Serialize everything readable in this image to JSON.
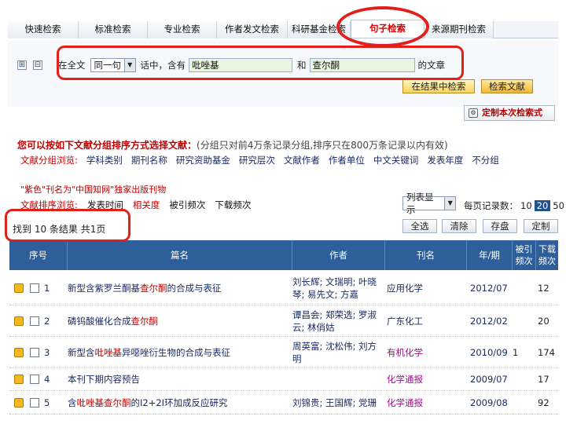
{
  "tabs": [
    "快速检索",
    "标准检索",
    "专业检索",
    "作者发文检索",
    "科研基金检索",
    "句子检索",
    "来源期刊检索"
  ],
  "search": {
    "expand_icon": "⊞",
    "collapse_icon": "⊟",
    "prefix": "在全文",
    "scope_select": "同一句",
    "middle": "话中，含有",
    "term1": "吡唑基",
    "conj": "和",
    "term2": "查尔酮",
    "suffix": "的文章",
    "btn_in_results": "在结果中检索",
    "btn_search": "检索文献",
    "custom_btn": "定制本次检索式"
  },
  "hint": {
    "bold": "您可以按如下文献分组排序方式选择文献：",
    "gray": "(分组只对前4万条记录分组,排序只在800万条记录以内有效)"
  },
  "group_browse": {
    "label": "文献分组浏览:",
    "items": [
      "学科类别",
      "期刊名称",
      "研究资助基金",
      "研究层次",
      "文献作者",
      "作者单位",
      "中文关键词",
      "发表年度",
      "不分组"
    ]
  },
  "promo": "\"紫色\"刊名为\"中国知网\"独家出版刊物",
  "sort": {
    "label": "文献排序浏览:",
    "items": [
      "发表时间",
      "相关度",
      "被引频次",
      "下载频次"
    ]
  },
  "display_select": "列表显示",
  "per_page": {
    "label": "每页记录数：",
    "options": [
      "10",
      "20",
      "50"
    ],
    "current": "20"
  },
  "found": "找到 10 条结果 共1页",
  "toolbar": [
    "全选",
    "清除",
    "存盘",
    "定制"
  ],
  "table": {
    "headers": [
      "序号",
      "篇名",
      "作者",
      "刊名",
      "年/期",
      "被引频次",
      "下载频次"
    ],
    "rows": [
      {
        "no": "1",
        "title_a": "新型含紫罗兰酮基",
        "title_hl": "查尔酮",
        "title_b": "的合成与表征",
        "authors": "刘长辉; 文瑞明; 叶晓琴; 易先文; 方嘉",
        "journal": "应用化学",
        "journal_style": "blue",
        "issue": "2012/07",
        "cited": "",
        "downloads": "12"
      },
      {
        "no": "2",
        "title_a": "磷钨酸催化合成",
        "title_hl": "查尔酮",
        "title_b": "",
        "authors": "谭昌会; 郑荣选; 罗淑云; 林俏姑",
        "journal": "广东化工",
        "journal_style": "blue",
        "issue": "2012/02",
        "cited": "",
        "downloads": "20"
      },
      {
        "no": "3",
        "title_a": "新型含",
        "title_hl": "吡唑基",
        "title_b": "异噁唑衍生物的合成与表征",
        "authors": "周英富; 沈松伟; 刘方明",
        "journal": "有机化学",
        "journal_style": "mag",
        "issue": "2010/09",
        "cited": "1",
        "downloads": "174"
      },
      {
        "no": "4",
        "title_a": "本刊下期内容预告",
        "title_hl": "",
        "title_b": "",
        "authors": "",
        "journal": "化学通报",
        "journal_style": "mag",
        "issue": "2009/07",
        "cited": "",
        "downloads": "17"
      },
      {
        "no": "5",
        "title_a": "含",
        "title_hl": "吡唑基查尔酮",
        "title_b": "的I2+2I环加成反应研究",
        "authors": "刘锦贵; 王国辉; 党珊",
        "journal": "化学通报",
        "journal_style": "mag",
        "issue": "2009/08",
        "cited": "",
        "downloads": "92"
      }
    ]
  }
}
